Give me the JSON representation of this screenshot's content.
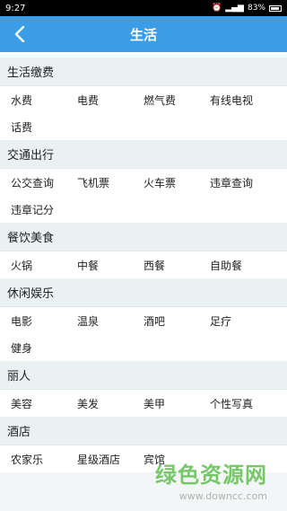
{
  "status": {
    "time": "9:27",
    "battery": "83%"
  },
  "header": {
    "title": "生活"
  },
  "sections": [
    {
      "title": "生活缴费",
      "items": [
        "水费",
        "电费",
        "燃气费",
        "有线电视",
        "话费"
      ]
    },
    {
      "title": "交通出行",
      "items": [
        "公交查询",
        "飞机票",
        "火车票",
        "违章查询",
        "违章记分"
      ]
    },
    {
      "title": "餐饮美食",
      "items": [
        "火锅",
        "中餐",
        "西餐",
        "自助餐"
      ]
    },
    {
      "title": "休闲娱乐",
      "items": [
        "电影",
        "温泉",
        "酒吧",
        "足疗",
        "健身"
      ]
    },
    {
      "title": "丽人",
      "items": [
        "美容",
        "美发",
        "美甲",
        "个性写真"
      ]
    },
    {
      "title": "酒店",
      "items": [
        "农家乐",
        "星级酒店",
        "宾馆"
      ]
    }
  ],
  "watermark": {
    "title": "绿色资源网",
    "url": "www.downcc.com"
  },
  "colors": {
    "header_bg": "#3a9de6",
    "section_bg": "#e9f1f2",
    "watermark": "#60be50"
  }
}
